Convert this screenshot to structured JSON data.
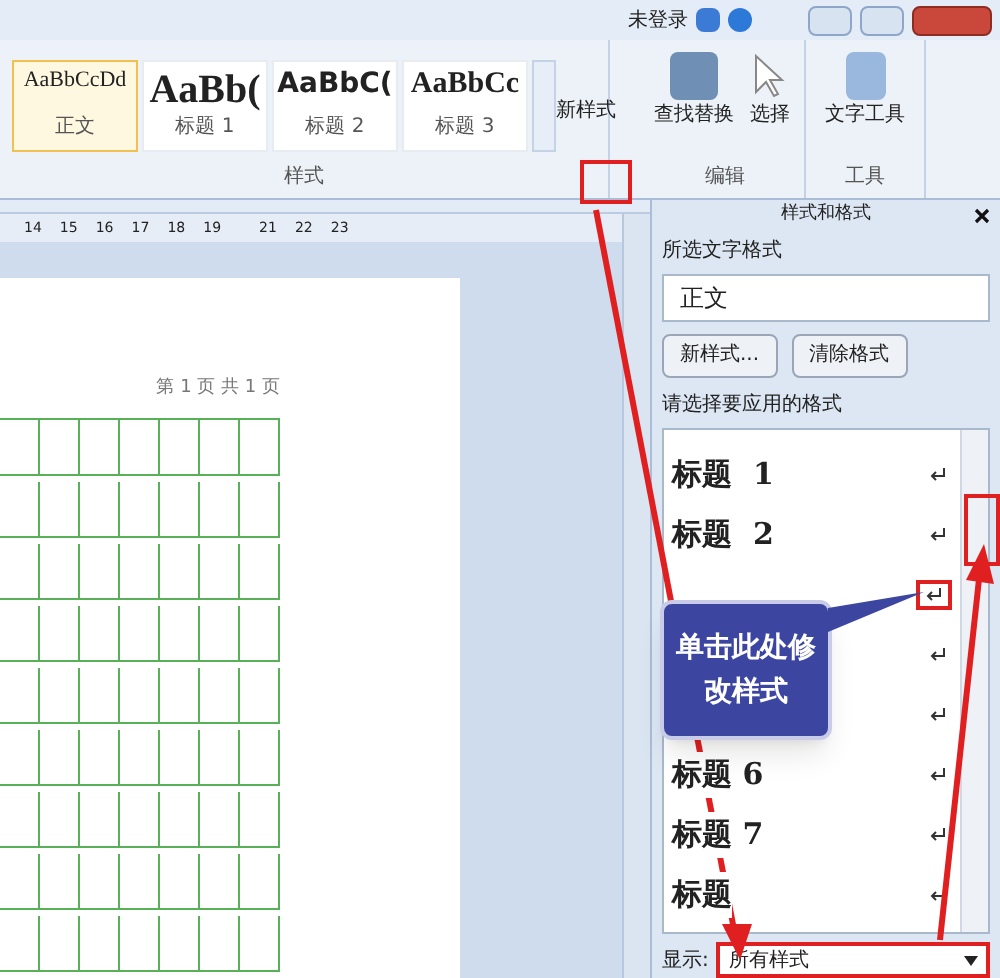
{
  "title_bar": {
    "login": "未登录"
  },
  "ribbon": {
    "gallery": [
      {
        "preview": "AaBbCcDd",
        "label": "正文",
        "selected": true,
        "kind": "normal"
      },
      {
        "preview": "AaBb(",
        "label": "标题 1",
        "selected": false,
        "kind": "h1"
      },
      {
        "preview": "AaBbC(",
        "label": "标题 2",
        "selected": false,
        "kind": "h2"
      },
      {
        "preview": "AaBbCc",
        "label": "标题 3",
        "selected": false,
        "kind": "h3"
      }
    ],
    "new_style": "新样式",
    "find_replace": "查找替换",
    "select": "选择",
    "text_tools": "文字工具",
    "groups": [
      "样式",
      "编辑",
      "工具"
    ]
  },
  "ruler": [
    "14",
    "15",
    "16",
    "17",
    "18",
    "19",
    "21",
    "22",
    "23"
  ],
  "page": {
    "header": "第 1 页 共 1 页"
  },
  "pane": {
    "title": "样式和格式",
    "selected_label": "所选文字格式",
    "current": "正文",
    "buttons": [
      "新样式...",
      "清除格式"
    ],
    "apply_label": "请选择要应用的格式",
    "styles": [
      {
        "label": "标题  1",
        "highlighted": false
      },
      {
        "label": "标题  2",
        "highlighted": false
      },
      {
        "highlighted": true
      },
      {
        "highlighted": false
      },
      {
        "highlighted": false
      },
      {
        "label": "标题 6",
        "highlighted": false
      },
      {
        "label": "标题 7",
        "highlighted": false
      },
      {
        "label": "标题",
        "highlighted": false
      }
    ],
    "show_label": "显示:",
    "show_value": "所有样式"
  },
  "callout": "单击此处修改样式"
}
